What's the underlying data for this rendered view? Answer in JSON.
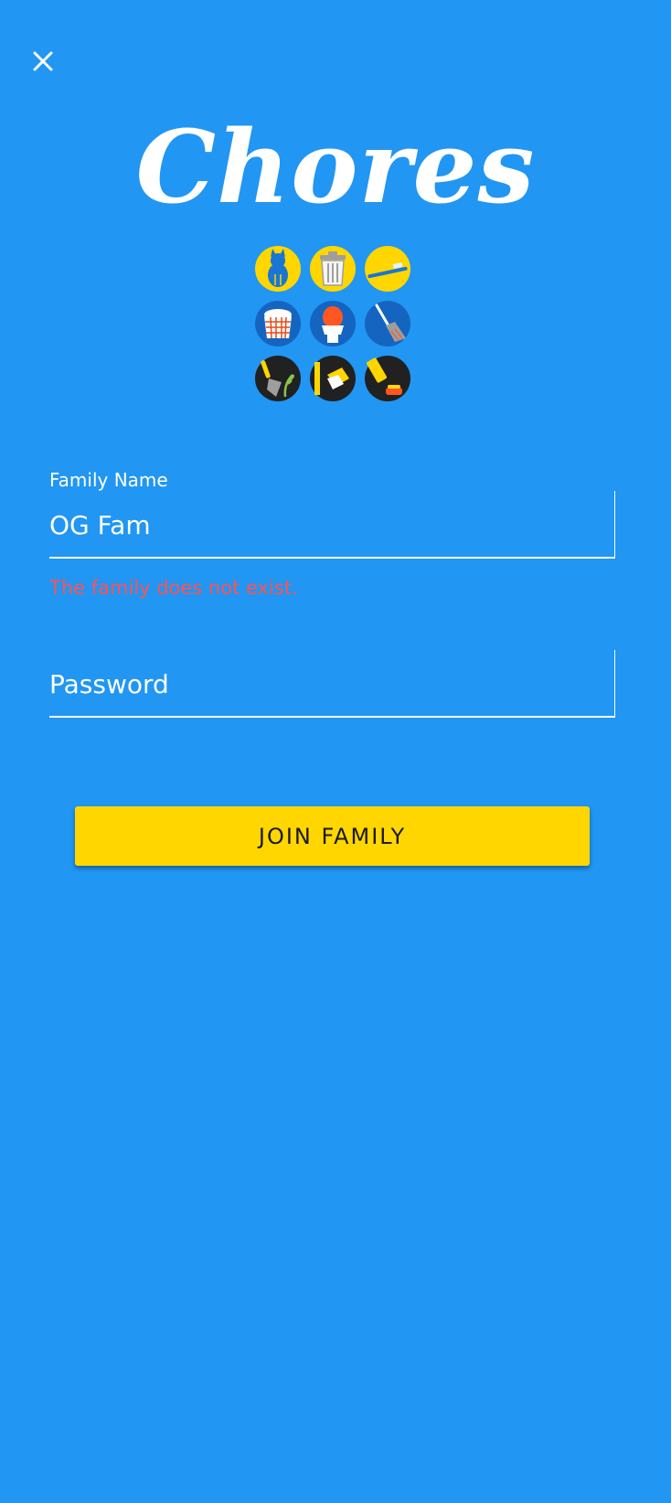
{
  "app": {
    "logo_text": "Chores",
    "background_color": "#2196F3"
  },
  "icons": {
    "close": "close-icon",
    "chores": [
      "cat-icon",
      "trash-can-icon",
      "toothbrush-icon",
      "laundry-basket-icon",
      "toilet-icon",
      "broom-icon",
      "garden-trowel-icon",
      "dusting-icon",
      "vacuum-icon"
    ]
  },
  "form": {
    "family_name": {
      "label": "Family Name",
      "value": "OG Fam",
      "error": "The family does not exist."
    },
    "password": {
      "placeholder": "Password"
    },
    "submit_label": "JOIN FAMILY"
  },
  "colors": {
    "primary": "#2196F3",
    "accent": "#FFD600",
    "error": "#FF5252",
    "text": "#ffffff"
  }
}
